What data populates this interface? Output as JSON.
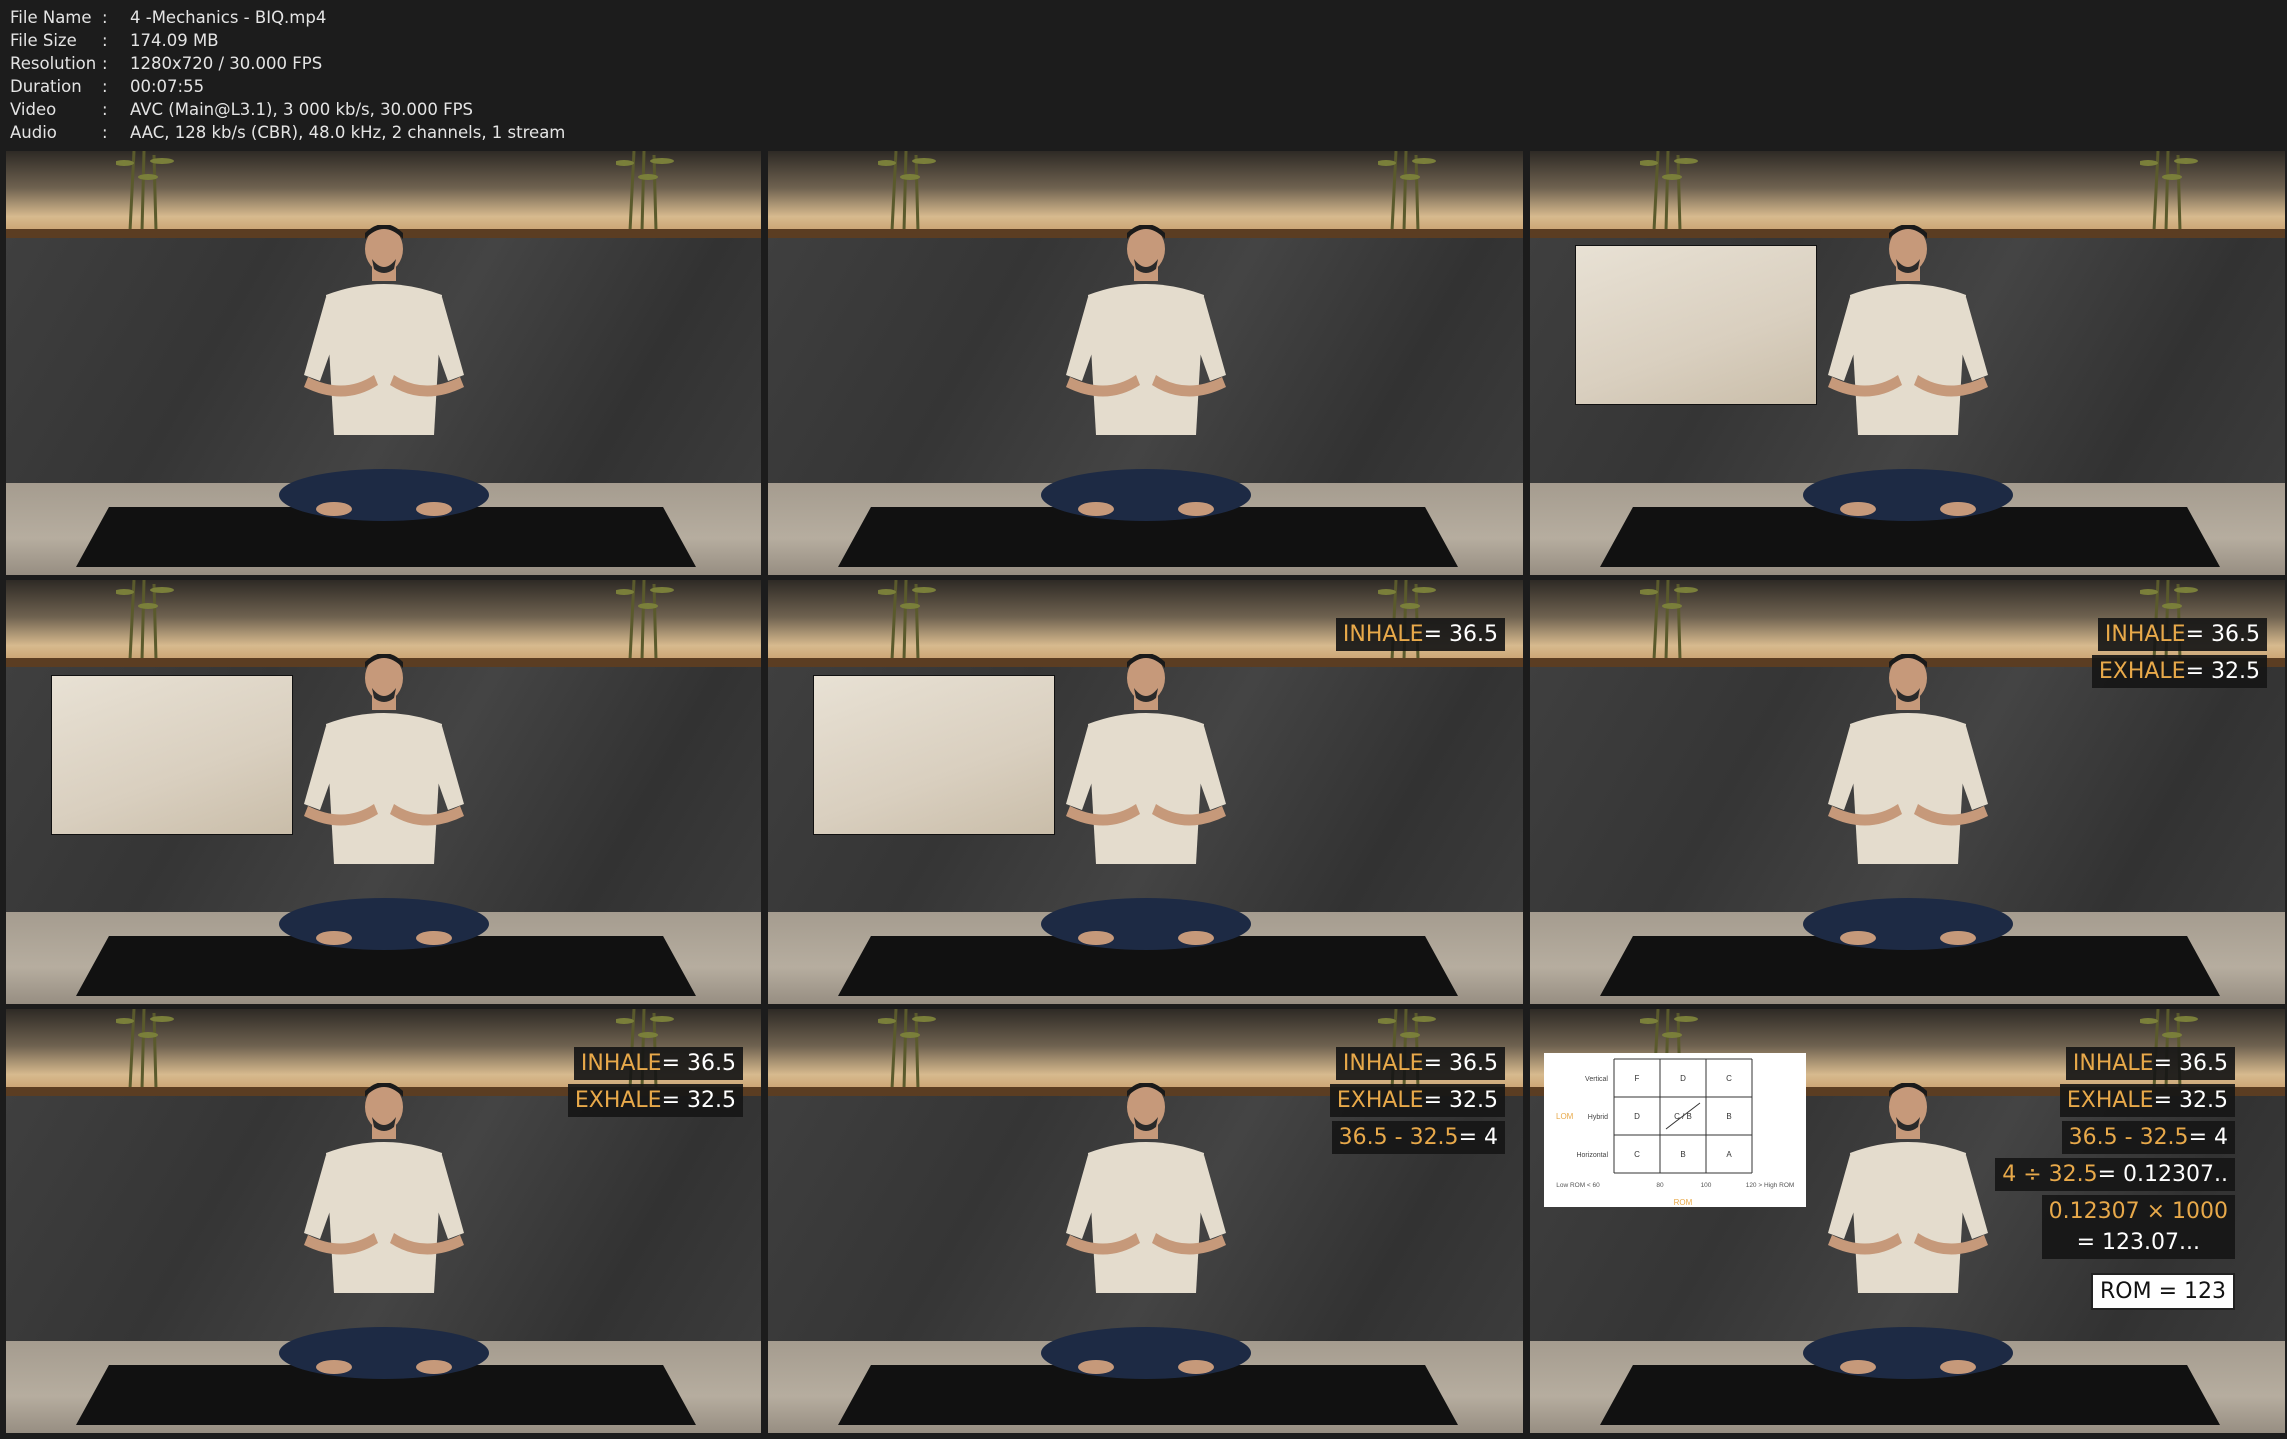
{
  "file_info": [
    {
      "key": "File Name",
      "value": "4 -Mechanics - BIQ.mp4"
    },
    {
      "key": "File Size",
      "value": "174.09 MB"
    },
    {
      "key": "Resolution",
      "value": "1280x720 / 30.000 FPS"
    },
    {
      "key": "Duration",
      "value": "00:07:55"
    },
    {
      "key": "Video",
      "value": "AVC (Main@L3.1), 3 000 kb/s, 30.000 FPS"
    },
    {
      "key": "Audio",
      "value": "AAC, 128 kb/s (CBR), 48.0 kHz, 2 channels, 1 stream"
    }
  ],
  "separator": ":",
  "colors": {
    "accent_orange": "#e8a94a",
    "label_bg": "#161616",
    "shirt": "#e4dccd",
    "pants": "#1d2a44"
  },
  "overlays": {
    "inhale_word": "INHALE",
    "inhale_value": "= 36.5",
    "exhale_word": "EXHALE",
    "exhale_value": "= 32.5",
    "diff_expr": "36.5 - 32.5",
    "diff_result": "= 4",
    "div_expr": "4 ÷ 32.5",
    "div_result": "= 0.12307..",
    "mult_expr": "0.12307 × 1000",
    "mult_result": "= 123.07...",
    "rom": "ROM = 123"
  },
  "chart": {
    "rows": [
      {
        "label": "Vertical",
        "cells": [
          "F",
          "D",
          "C"
        ]
      },
      {
        "label": "Hybrid",
        "cells": [
          "D",
          "C / B",
          "B"
        ]
      },
      {
        "label": "Horizontal",
        "cells": [
          "C",
          "B",
          "A"
        ]
      }
    ],
    "side_label": "LOM",
    "x_ticks": [
      "Low ROM  <  60",
      "80",
      "100",
      "120  >  High ROM"
    ],
    "x_label": "ROM"
  }
}
